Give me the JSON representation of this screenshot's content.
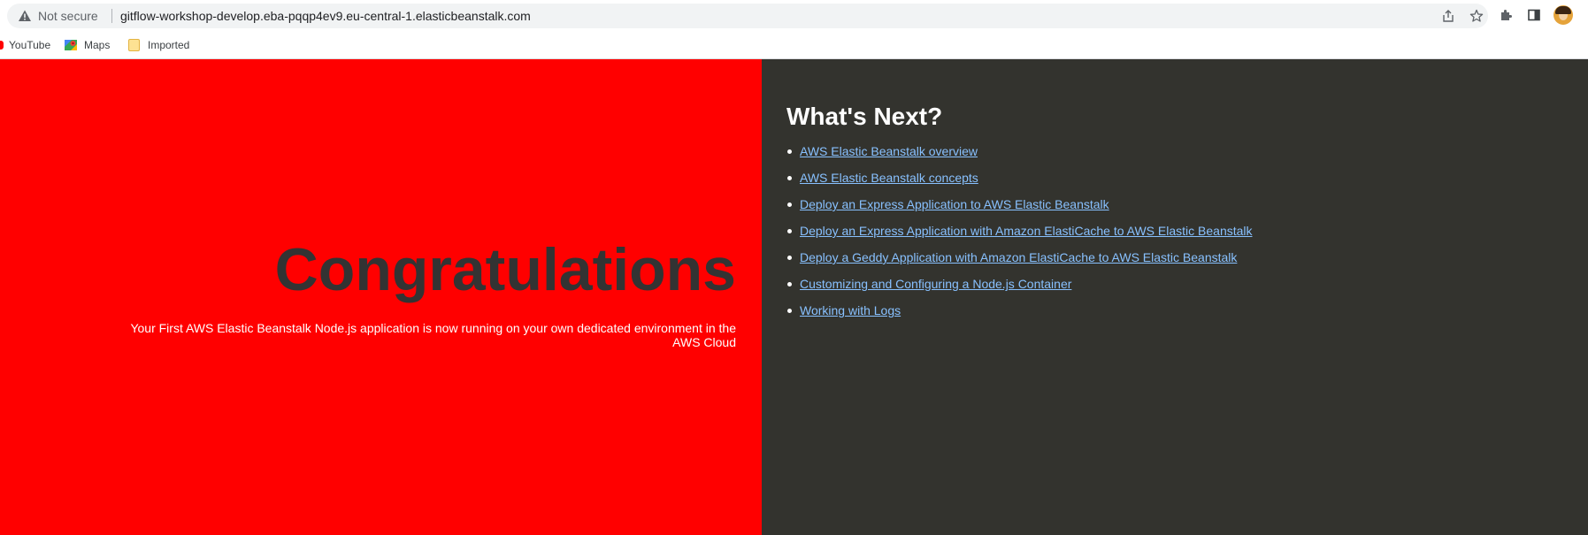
{
  "browser": {
    "security_label": "Not secure",
    "url": "gitflow-workshop-develop.eba-pqqp4ev9.eu-central-1.elasticbeanstalk.com",
    "bookmarks": [
      {
        "label": "YouTube",
        "icon": "youtube-icon"
      },
      {
        "label": "Maps",
        "icon": "maps-icon"
      },
      {
        "label": "Imported",
        "icon": "folder-icon"
      }
    ],
    "toolbar_icons": [
      "share-icon",
      "star-icon",
      "extensions-icon",
      "side-panel-icon",
      "profile-avatar"
    ]
  },
  "hero": {
    "heading": "Congratulations",
    "subtitle": "Your First AWS Elastic Beanstalk Node.js application is now running on your own dedicated environment in the AWS Cloud"
  },
  "next": {
    "title": "What's Next?",
    "links": [
      "AWS Elastic Beanstalk overview",
      "AWS Elastic Beanstalk concepts",
      "Deploy an Express Application to AWS Elastic Beanstalk",
      "Deploy an Express Application with Amazon ElastiCache to AWS Elastic Beanstalk",
      "Deploy a Geddy Application with Amazon ElastiCache to AWS Elastic Beanstalk",
      "Customizing and Configuring a Node.js Container",
      "Working with Logs"
    ]
  },
  "colors": {
    "left_background": "#ff0000",
    "right_background": "#33332e",
    "heading_text": "#333333",
    "link": "#88c1ff"
  }
}
